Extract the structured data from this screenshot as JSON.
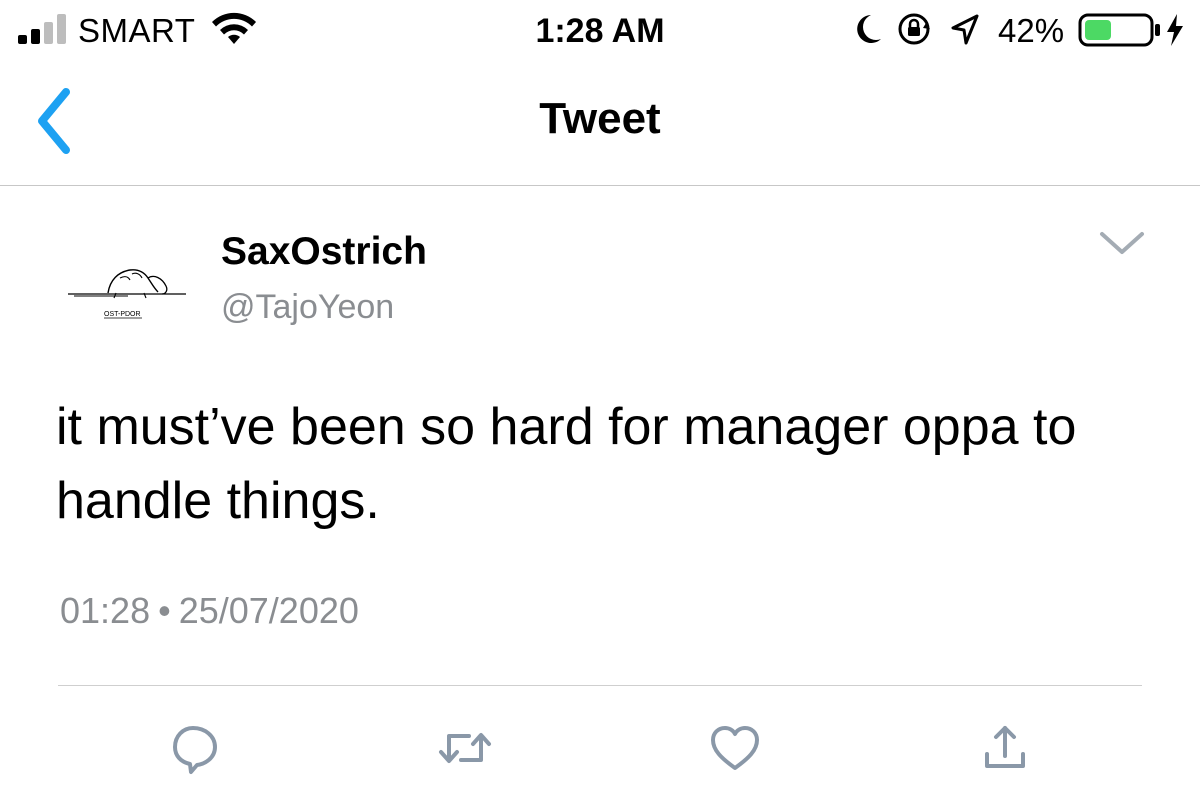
{
  "status_bar": {
    "carrier": "SMART",
    "time": "1:28 AM",
    "battery_percent": "42%",
    "battery_level": 0.42,
    "icons": [
      "signal-icon",
      "wifi-icon",
      "moon-icon",
      "rotation-lock-icon",
      "location-icon",
      "battery-icon",
      "charging-bolt-icon"
    ]
  },
  "nav": {
    "title": "Tweet",
    "back_icon": "chevron-left-icon"
  },
  "tweet": {
    "display_name": "SaxOstrich",
    "handle": "@TajoYeon",
    "text": "it must’ve been so hard for manager oppa to handle things.",
    "time": "01:28",
    "separator": "•",
    "date": "25/07/2020",
    "more_icon": "chevron-down-icon"
  },
  "actions": [
    {
      "icon": "reply-icon"
    },
    {
      "icon": "retweet-icon"
    },
    {
      "icon": "like-icon"
    },
    {
      "icon": "share-icon"
    }
  ],
  "colors": {
    "accent": "#1da1f2",
    "secondary_text": "#8a8d91",
    "action_icon": "#8a98a8",
    "battery_fill": "#4cd964"
  }
}
